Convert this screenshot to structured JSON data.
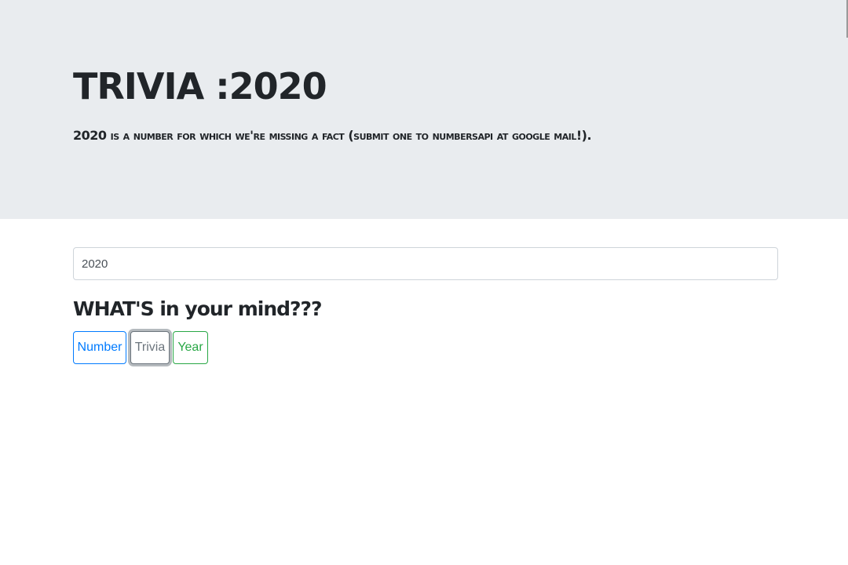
{
  "header": {
    "title": "TRIVIA :2020",
    "lead": "2020 is a number for which we're missing a fact (submit one to numbersapi at google mail!)."
  },
  "form": {
    "number_value": "2020",
    "question": "WHAT'S in your mind???"
  },
  "buttons": {
    "number_label": "Number",
    "trivia_label": "Trivia",
    "year_label": "Year"
  },
  "colors": {
    "jumbotron_bg": "#e9ecef",
    "primary": "#007bff",
    "secondary": "#6c757d",
    "success": "#28a745"
  }
}
